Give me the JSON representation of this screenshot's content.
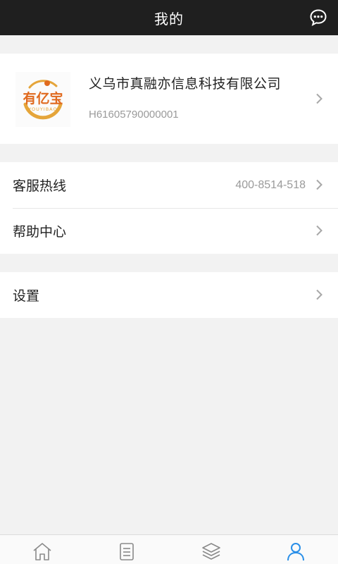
{
  "header": {
    "title": "我的",
    "message_icon": "chat-bubble-icon"
  },
  "profile": {
    "company_name": "义乌市真融亦信息科技有限公司",
    "company_id": "H61605790000001",
    "logo": {
      "text": "有亿宝",
      "subtext": "YOUYIBAO",
      "color": "#e06a1f",
      "accent": "#e5a53a"
    }
  },
  "menu": {
    "hotline_label": "客服热线",
    "hotline_value": "400-8514-518",
    "help_label": "帮助中心",
    "settings_label": "设置"
  },
  "tabbar": {
    "tabs": [
      {
        "icon": "home-icon",
        "active": false
      },
      {
        "icon": "document-list-icon",
        "active": false
      },
      {
        "icon": "layers-icon",
        "active": false
      },
      {
        "icon": "user-icon",
        "active": true
      }
    ],
    "active_color": "#2a8fe8",
    "inactive_color": "#8a8a8a"
  }
}
